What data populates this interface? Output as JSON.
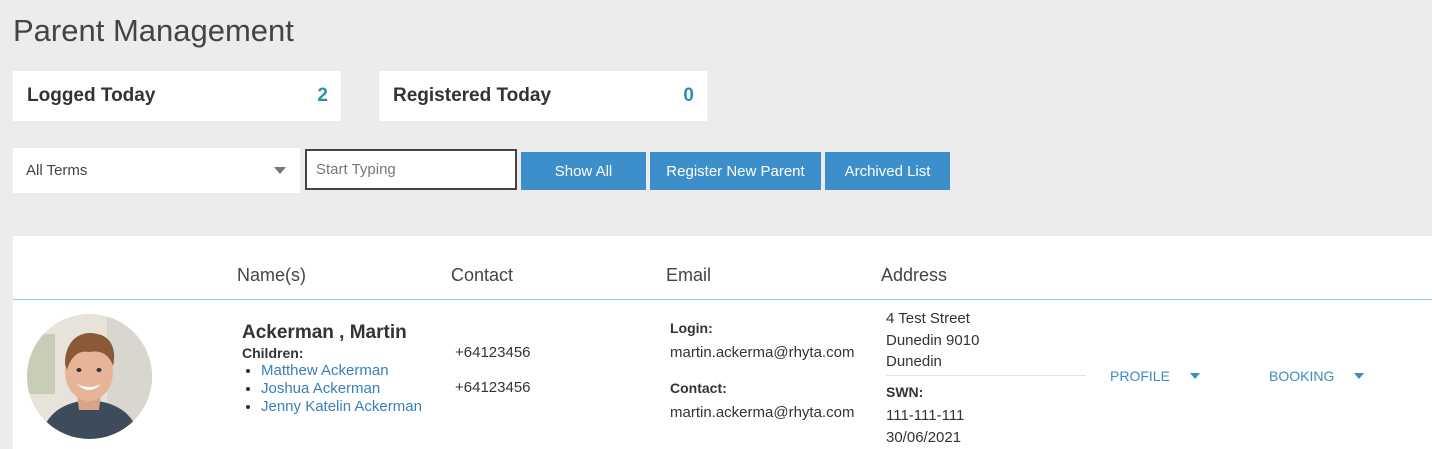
{
  "page": {
    "title": "Parent Management"
  },
  "stats": [
    {
      "label": "Logged Today",
      "value": "2"
    },
    {
      "label": "Registered Today",
      "value": "0"
    }
  ],
  "filters": {
    "term_select": "All Terms",
    "search_placeholder": "Start Typing",
    "show_all": "Show All",
    "register_new": "Register New Parent",
    "archived": "Archived List"
  },
  "table": {
    "headers": [
      "Name(s)",
      "Contact",
      "Email",
      "Address"
    ],
    "rows": [
      {
        "name": "Ackerman , Martin",
        "children_label": "Children:",
        "children": [
          "Matthew Ackerman",
          "Joshua Ackerman",
          "Jenny Katelin Ackerman"
        ],
        "phones": [
          "+64123456",
          "+64123456"
        ],
        "login_label": "Login:",
        "login_email": "martin.ackerma@rhyta.com",
        "contact_label": "Contact:",
        "contact_email": "martin.ackerma@rhyta.com",
        "address": [
          "4 Test Street",
          "Dunedin 9010",
          "Dunedin"
        ],
        "swn_label": "SWN:",
        "swn": "111-111-111",
        "swn_date": "30/06/2021",
        "profile_label": "PROFILE",
        "booking_label": "BOOKING"
      }
    ]
  },
  "colors": {
    "accent": "#3d8fcb",
    "stat_value": "#2b8fb3",
    "link": "#3a7fb8",
    "background": "#ececec"
  }
}
